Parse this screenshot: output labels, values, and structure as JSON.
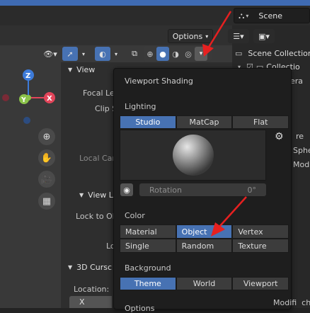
{
  "header": {
    "scene_name": "Scene",
    "options_label": "Options"
  },
  "outliner": {
    "scene_collection": "Scene Collection",
    "collection_partial": "Collectio",
    "items_partial": [
      "era",
      "re",
      "Sphe",
      "Modi"
    ]
  },
  "npanel": {
    "view_header": "View",
    "focal_length_partial": "Focal Le",
    "clip_partial": "Clip S",
    "local_cam_partial": "Local Car",
    "view_lock_header_partial": "View L",
    "lock_to_object_partial": "Lock to Ob",
    "lock_partial": "Lo",
    "cursor_header_partial": "3D Cursc",
    "location_label": "Location:",
    "x_label": "X"
  },
  "shading_popup": {
    "title": "Viewport Shading",
    "lighting_label": "Lighting",
    "lighting_options": [
      "Studio",
      "MatCap",
      "Flat"
    ],
    "lighting_selected": "Studio",
    "rotation_label": "Rotation",
    "rotation_value": "0°",
    "color_label": "Color",
    "color_options": [
      "Material",
      "Object",
      "Vertex",
      "Single",
      "Random",
      "Texture"
    ],
    "color_selected": "Object",
    "background_label": "Background",
    "background_options": [
      "Theme",
      "World",
      "Viewport"
    ],
    "background_selected": "Theme",
    "options_partial": "Options"
  },
  "right_bottom_partial": "Modifi  chs",
  "colors": {
    "accent_blue": "#4772b3",
    "annotation_red": "#e62020",
    "axis_x_red": "#e3455a",
    "axis_y_green": "#8bc34a",
    "axis_z_blue": "#3d7bd9"
  }
}
